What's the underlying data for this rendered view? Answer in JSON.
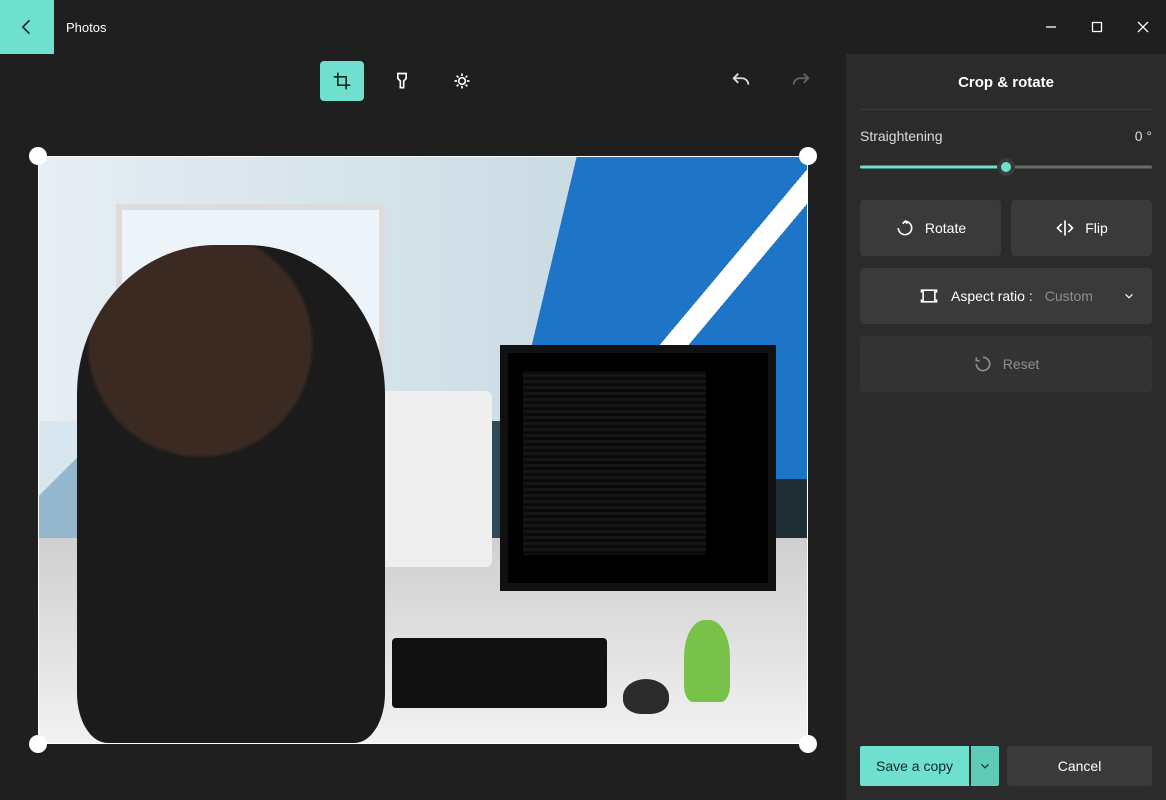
{
  "app": {
    "title": "Photos"
  },
  "tools": {
    "crop": "Crop & rotate",
    "filters": "Filters",
    "adjust": "Adjustments",
    "undo": "Undo",
    "redo": "Redo"
  },
  "panel": {
    "title": "Crop & rotate",
    "straighten_label": "Straightening",
    "straighten_value": "0 °",
    "rotate": "Rotate",
    "flip": "Flip",
    "aspect_label": "Aspect ratio :",
    "aspect_value": "Custom",
    "reset": "Reset",
    "save": "Save a copy",
    "cancel": "Cancel"
  },
  "window": {
    "minimize": "Minimize",
    "maximize": "Maximize",
    "close": "Close"
  }
}
